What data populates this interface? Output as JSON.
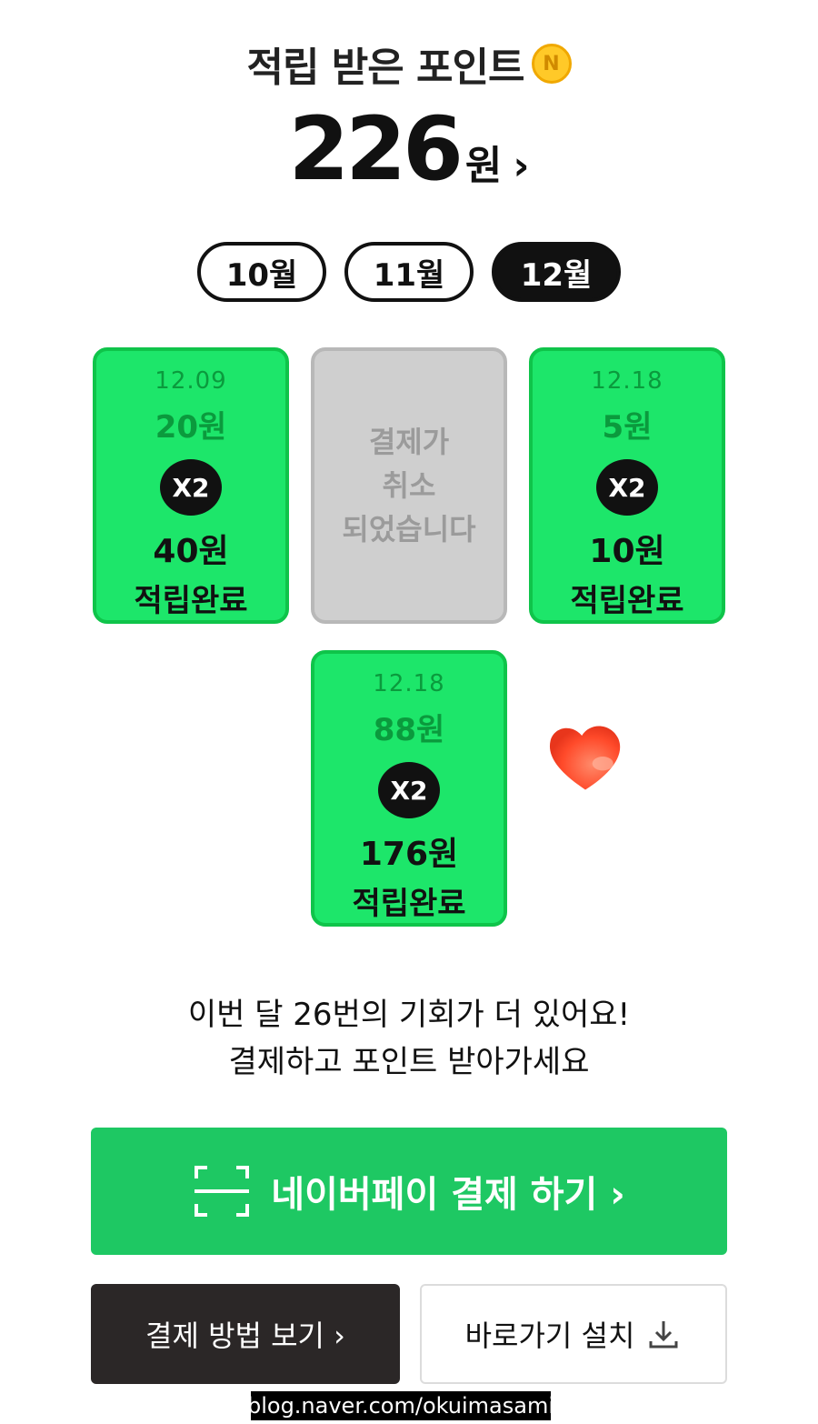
{
  "header": {
    "title": "적립 받은 포인트",
    "coin_symbol": "N",
    "points_amount": "226",
    "points_unit": "원",
    "points_chevron": "›"
  },
  "months": [
    {
      "label": "10월",
      "active": false
    },
    {
      "label": "11월",
      "active": false
    },
    {
      "label": "12월",
      "active": true
    }
  ],
  "cards": [
    {
      "date": "12.09",
      "base": "20원",
      "multiplier": "X2",
      "total": "40원",
      "status": "적립완료"
    },
    {
      "cancel_text": "결제가\n취소\n되었습니다"
    },
    {
      "date": "12.18",
      "base": "5원",
      "multiplier": "X2",
      "total": "10원",
      "status": "적립완료"
    },
    {
      "date": "12.18",
      "base": "88원",
      "multiplier": "X2",
      "total": "176원",
      "status": "적립완료"
    }
  ],
  "message": {
    "line1": "이번 달 26번의 기회가 더 있어요!",
    "line2": "결제하고 포인트 받아가세요"
  },
  "buttons": {
    "pay": "네이버페이 결제 하기 ›",
    "method": "결제 방법 보기 ›",
    "shortcut": "바로가기 설치"
  },
  "watermark": "blog.naver.com/okuimasami",
  "colors": {
    "green": "#1de66a",
    "pay_green": "#1ec863",
    "dark": "#2b2727"
  }
}
